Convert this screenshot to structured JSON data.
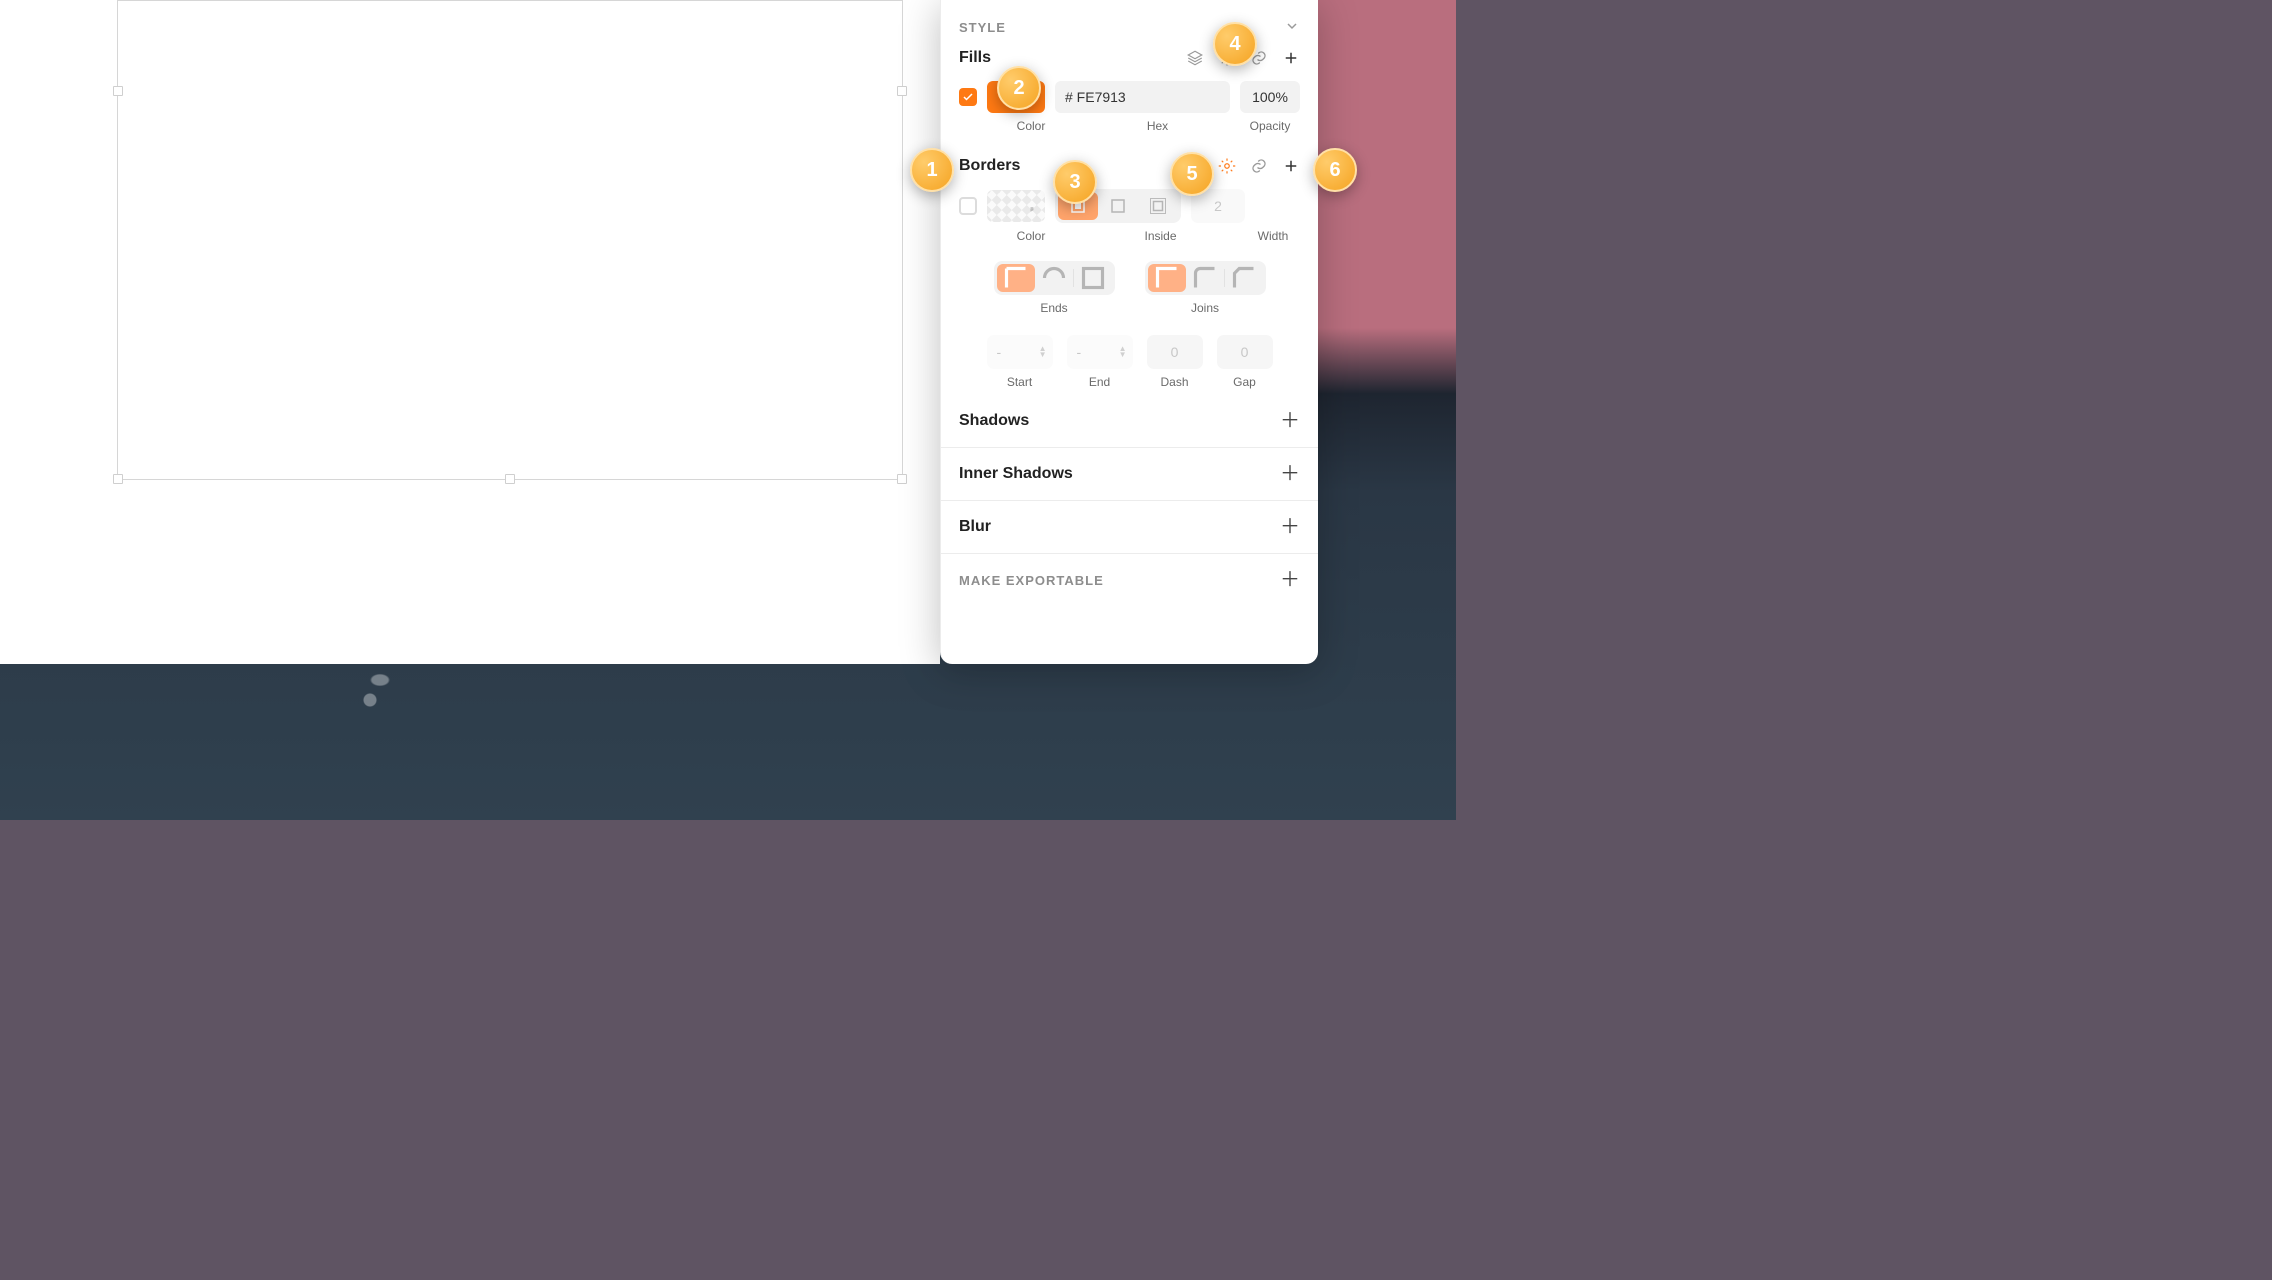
{
  "inspector": {
    "style_label": "STYLE",
    "fills": {
      "title": "Fills",
      "hex": "# FE7913",
      "opacity": "100%",
      "lbl_color": "Color",
      "lbl_hex": "Hex",
      "lbl_opacity": "Opacity"
    },
    "borders": {
      "title": "Borders",
      "width": "2",
      "lbl_color": "Color",
      "lbl_pos": "Inside",
      "lbl_width": "Width",
      "ends": "Ends",
      "joins": "Joins",
      "start": "-",
      "end": "-",
      "dash": "0",
      "gap": "0",
      "lbl_start": "Start",
      "lbl_end": "End",
      "lbl_dash": "Dash",
      "lbl_gap": "Gap"
    },
    "shadows": "Shadows",
    "inner_shadows": "Inner Shadows",
    "blur": "Blur",
    "export": "MAKE EXPORTABLE"
  },
  "markers": [
    "1",
    "2",
    "3",
    "4",
    "5",
    "6"
  ],
  "shape": {
    "fill": "#FE7913"
  }
}
